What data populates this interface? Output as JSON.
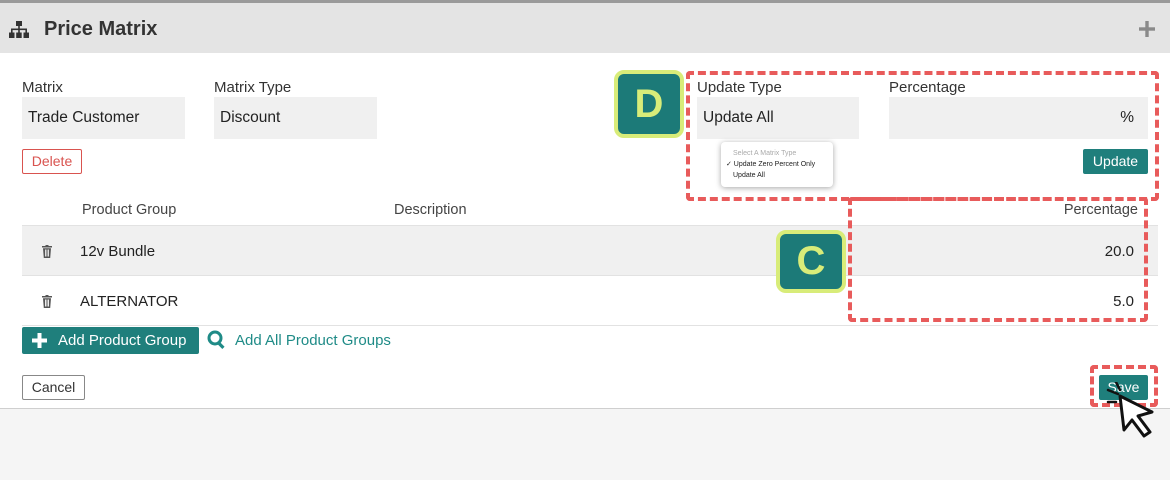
{
  "header": {
    "title": "Price Matrix",
    "icon": "sitemap-icon",
    "action_icon": "plus-icon"
  },
  "form": {
    "matrix_label": "Matrix",
    "matrix_value": "Trade Customer",
    "matrix_type_label": "Matrix Type",
    "matrix_type_value": "Discount",
    "delete_label": "Delete",
    "update_type_label": "Update Type",
    "update_type_value": "Update All",
    "percentage_label": "Percentage",
    "percentage_suffix": "%",
    "update_label": "Update"
  },
  "update_type_dropdown": {
    "header": "Select A Matrix Type",
    "options": [
      {
        "label": "✓ Update Zero Percent Only"
      },
      {
        "label": "Update All"
      }
    ]
  },
  "table": {
    "columns": [
      "Product Group",
      "Description",
      "Percentage"
    ],
    "rows": [
      {
        "product_group": "12v Bundle",
        "description": "",
        "percentage": "20.0"
      },
      {
        "product_group": "ALTERNATOR",
        "description": "",
        "percentage": "5.0"
      }
    ]
  },
  "actions": {
    "add_product_group": "Add Product Group",
    "add_all_product_groups": "Add All Product Groups",
    "cancel": "Cancel",
    "save": "Save"
  },
  "annotations": {
    "badge_d": "D",
    "badge_c": "C"
  },
  "colors": {
    "accent": "#1f7f7c",
    "danger": "#d9534f",
    "highlight_dash": "#e85b5b",
    "badge_fill": "#1c7a78",
    "badge_border": "#d8ec79"
  }
}
